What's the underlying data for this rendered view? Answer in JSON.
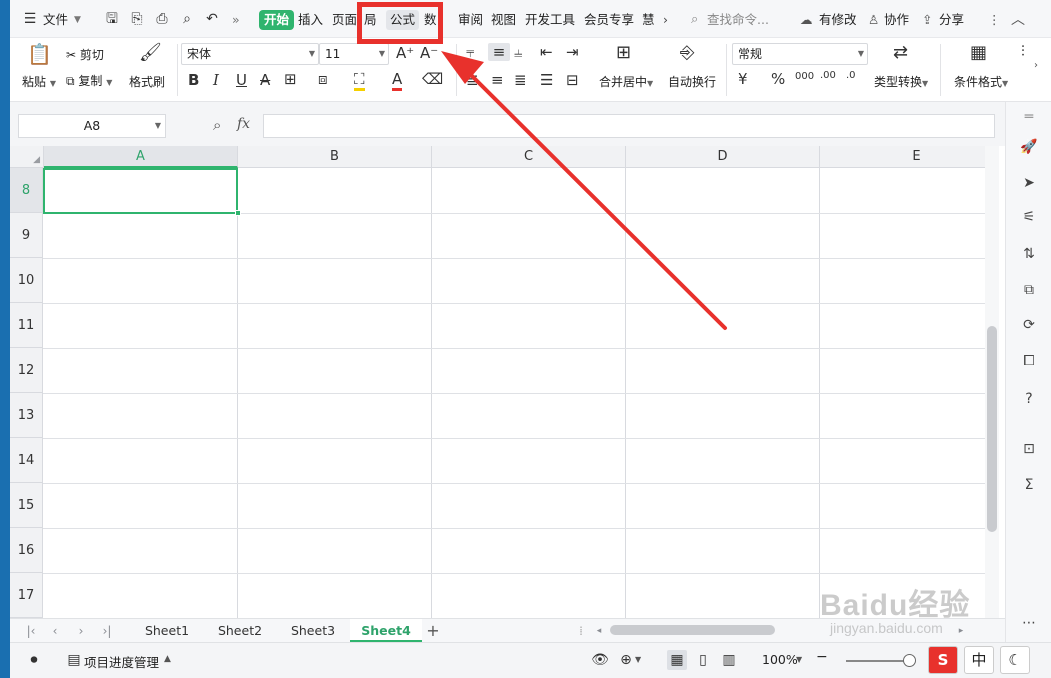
{
  "menubar": {
    "file_label": "文件",
    "tabs": [
      "开始",
      "插入",
      "页面",
      "局",
      "公式",
      "数",
      "审阅",
      "视图",
      "开发工具",
      "会员专享",
      "慧"
    ],
    "search_placeholder": "查找命令...",
    "modified_label": "有修改",
    "collab_label": "协作",
    "share_label": "分享"
  },
  "ribbon": {
    "paste_label": "粘贴",
    "cut_label": "剪切",
    "copy_label": "复制",
    "format_painter_label": "格式刷",
    "font_name": "宋体",
    "font_size": "11",
    "merge_label": "合并居中",
    "wrap_label": "自动换行",
    "number_format": "常规",
    "type_convert_label": "类型转换",
    "cond_format_label": "条件格式"
  },
  "formula_bar": {
    "name_box": "A8",
    "fx_label": "fx",
    "formula_value": ""
  },
  "grid": {
    "columns": [
      "A",
      "B",
      "C",
      "D",
      "E"
    ],
    "rows": [
      "8",
      "9",
      "10",
      "11",
      "12",
      "13",
      "14",
      "15",
      "16",
      "17"
    ],
    "active_cell": "A8"
  },
  "sheets": {
    "tabs": [
      "Sheet1",
      "Sheet2",
      "Sheet3",
      "Sheet4"
    ],
    "active": "Sheet4"
  },
  "statusbar": {
    "project_label": "项目进度管理",
    "zoom": "100%"
  },
  "ime": {
    "lang_label": "中"
  },
  "watermark": {
    "main": "Baidu经验",
    "sub": "jingyan.baidu.com"
  },
  "colors": {
    "accent": "#2fb46e",
    "annotation": "#e8312c",
    "desktop": "#1a6fb0"
  }
}
